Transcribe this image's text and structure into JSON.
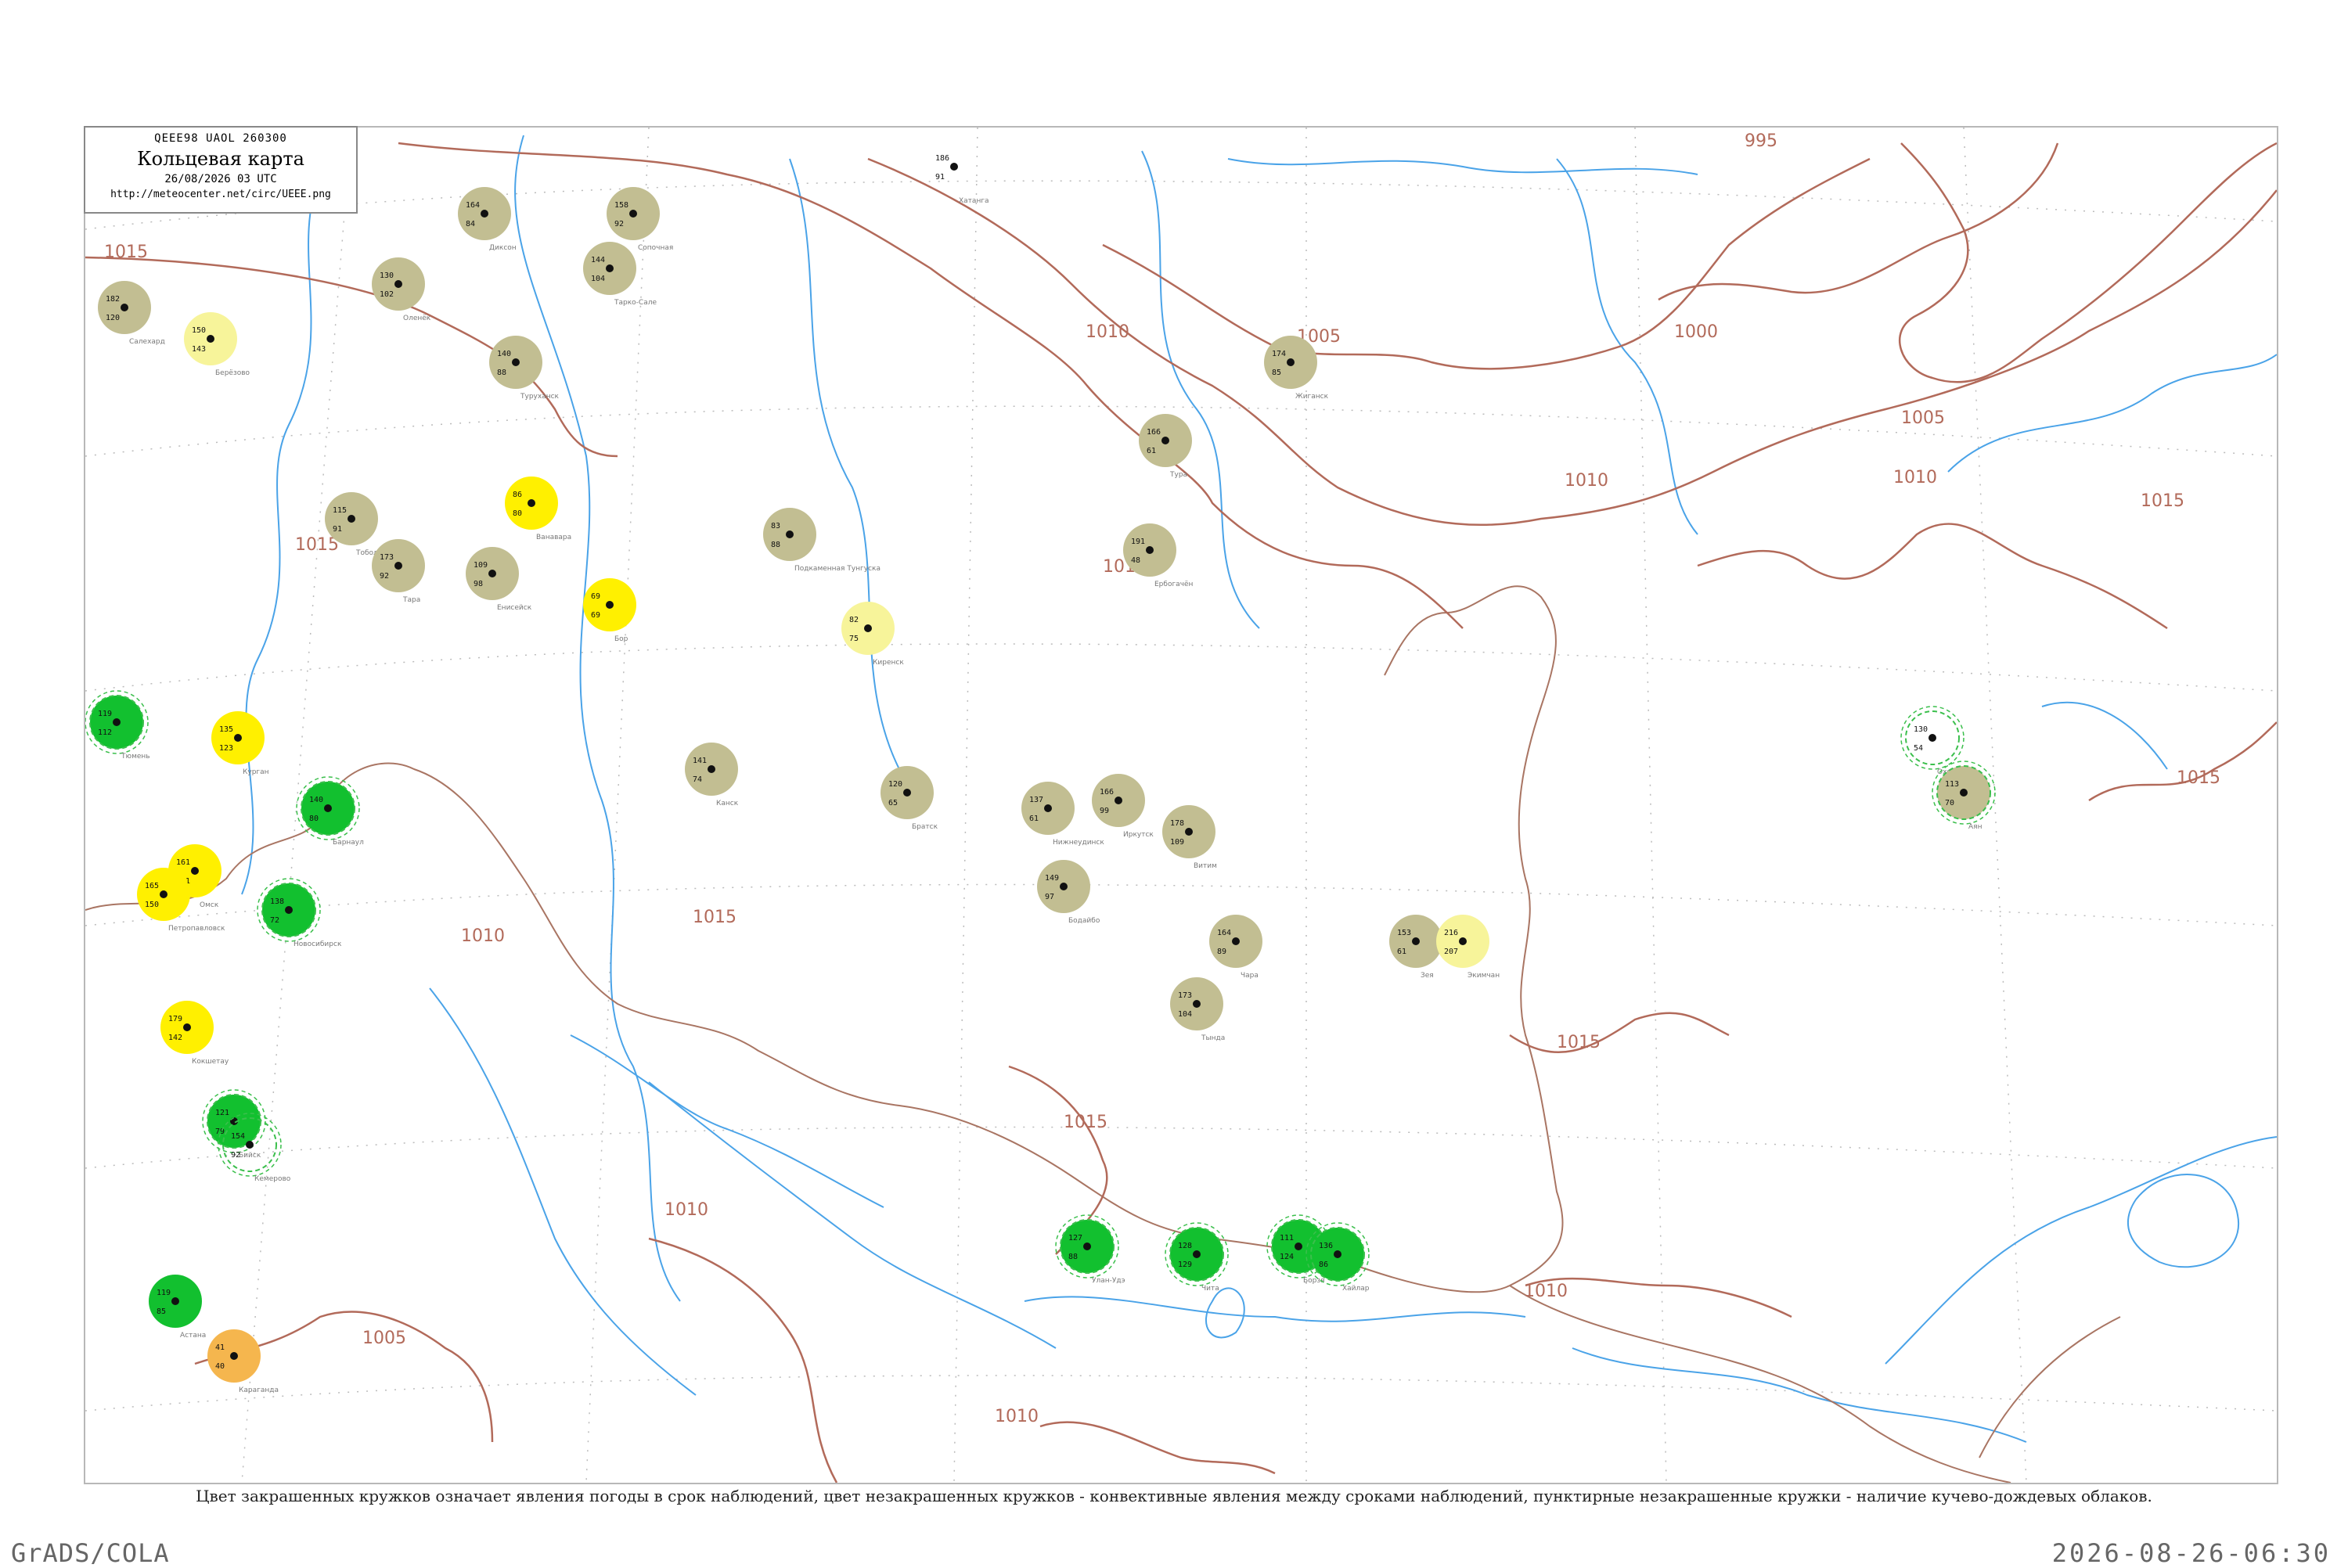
{
  "title": {
    "codes": "QEEE98  UAOL  260300",
    "main": "Кольцевая карта",
    "date": "26/08/2026 03 UTC",
    "url": "http://meteocenter.net/circ/UEEE.png"
  },
  "caption": "Цвет закрашенных кружков означает явления погоды в срок наблюдений, цвет незакрашенных кружков - конвективные явления между сроками наблюдений, пунктирные незакрашенные кружки - наличие кучево-дождевых облаков.",
  "footer": {
    "left": "GrADS/COLA",
    "right": "2026-08-26-06:30"
  },
  "colors": {
    "isobar": "#b26a5a",
    "river": "#4aa3e8",
    "olive": "#c2be92",
    "green": "#12c02f",
    "yellow": "#fff000",
    "light_yellow": "#f7f49a",
    "orange": "#f5b64e",
    "dashed_green": "#3bbf4c"
  },
  "isobars": [
    "1015",
    "1010",
    "1010",
    "1005",
    "1000",
    "995",
    "1005",
    "1010",
    "1015",
    "1010",
    "1015",
    "1010",
    "1015",
    "1010",
    "1005",
    "1010",
    "1015"
  ],
  "stations": [
    {
      "label": "164",
      "sub": "84",
      "name": "Диксон",
      "fill": "olive",
      "dashed": false
    },
    {
      "label": "158",
      "sub": "92",
      "name": "Сопочная",
      "fill": "olive",
      "dashed": false
    },
    {
      "label": "144",
      "sub": "104",
      "name": "Тарко-Сале",
      "fill": "olive",
      "dashed": false
    },
    {
      "label": "186",
      "sub": "91",
      "name": "Хатанга",
      "fill": "none",
      "dashed": false
    },
    {
      "label": "130",
      "sub": "102",
      "name": "Оленёк",
      "fill": "olive",
      "dashed": false
    },
    {
      "label": "182",
      "sub": "120",
      "name": "Салехард",
      "fill": "olive",
      "dashed": false
    },
    {
      "label": "150",
      "sub": "143",
      "name": "Берёзово",
      "fill": "light_yellow",
      "dashed": false
    },
    {
      "label": "140",
      "sub": "88",
      "name": "Туруханск",
      "fill": "olive",
      "dashed": false
    },
    {
      "label": "174",
      "sub": "85",
      "name": "Жиганск",
      "fill": "olive",
      "dashed": false
    },
    {
      "label": "166",
      "sub": "61",
      "name": "Тура",
      "fill": "olive",
      "dashed": false
    },
    {
      "label": "191",
      "sub": "48",
      "name": "Ербогачён",
      "fill": "olive",
      "dashed": false
    },
    {
      "label": "86",
      "sub": "80",
      "name": "Ванавара",
      "fill": "yellow",
      "dashed": false
    },
    {
      "label": "69",
      "sub": "69",
      "name": "Бор",
      "fill": "yellow",
      "dashed": false
    },
    {
      "label": "83",
      "sub": "88",
      "name": "Подкаменная Тунгуска",
      "fill": "olive",
      "dashed": false
    },
    {
      "label": "82",
      "sub": "75",
      "name": "Киренск",
      "fill": "light_yellow",
      "dashed": false
    },
    {
      "label": "115",
      "sub": "91",
      "name": "Тобольск",
      "fill": "olive",
      "dashed": false
    },
    {
      "label": "173",
      "sub": "92",
      "name": "Тара",
      "fill": "olive",
      "dashed": false
    },
    {
      "label": "109",
      "sub": "98",
      "name": "Енисейск",
      "fill": "olive",
      "dashed": false
    },
    {
      "label": "141",
      "sub": "74",
      "name": "Канск",
      "fill": "olive",
      "dashed": false
    },
    {
      "label": "120",
      "sub": "65",
      "name": "Братск",
      "fill": "olive",
      "dashed": false
    },
    {
      "label": "137",
      "sub": "61",
      "name": "Нижнеудинск",
      "fill": "olive",
      "dashed": false
    },
    {
      "label": "166",
      "sub": "99",
      "name": "Иркутск",
      "fill": "olive",
      "dashed": false
    },
    {
      "label": "178",
      "sub": "109",
      "name": "Витим",
      "fill": "olive",
      "dashed": false
    },
    {
      "label": "149",
      "sub": "97",
      "name": "Бодайбо",
      "fill": "olive",
      "dashed": false
    },
    {
      "label": "164",
      "sub": "89",
      "name": "Чара",
      "fill": "olive",
      "dashed": false
    },
    {
      "label": "173",
      "sub": "104",
      "name": "Тында",
      "fill": "olive",
      "dashed": false
    },
    {
      "label": "153",
      "sub": "61",
      "name": "Зея",
      "fill": "olive",
      "dashed": false
    },
    {
      "label": "216",
      "sub": "207",
      "name": "Экимчан",
      "fill": "light_yellow",
      "dashed": false
    },
    {
      "label": "130",
      "sub": "54",
      "name": "Охотск",
      "fill": "none",
      "dashed": true
    },
    {
      "label": "113",
      "sub": "70",
      "name": "Аян",
      "fill": "olive",
      "dashed": true
    },
    {
      "label": "119",
      "sub": "112",
      "name": "Тюмень",
      "fill": "green",
      "dashed": true
    },
    {
      "label": "135",
      "sub": "123",
      "name": "Курган",
      "fill": "yellow",
      "dashed": false
    },
    {
      "label": "161",
      "sub": "141",
      "name": "Омск",
      "fill": "yellow",
      "dashed": false
    },
    {
      "label": "165",
      "sub": "150",
      "name": "Петропавловск",
      "fill": "yellow",
      "dashed": false
    },
    {
      "label": "179",
      "sub": "142",
      "name": "Кокшетау",
      "fill": "yellow",
      "dashed": false
    },
    {
      "label": "138",
      "sub": "72",
      "name": "Новосибирск",
      "fill": "green",
      "dashed": true
    },
    {
      "label": "140",
      "sub": "80",
      "name": "Барнаул",
      "fill": "green",
      "dashed": true
    },
    {
      "label": "121",
      "sub": "79",
      "name": "Бийск",
      "fill": "green",
      "dashed": true
    },
    {
      "label": "154",
      "sub": "92",
      "name": "Кемерово",
      "fill": "none",
      "dashed": true
    },
    {
      "label": "119",
      "sub": "85",
      "name": "Астана",
      "fill": "green",
      "dashed": false
    },
    {
      "label": "41",
      "sub": "40",
      "name": "Караганда",
      "fill": "orange",
      "dashed": false
    },
    {
      "label": "127",
      "sub": "88",
      "name": "Улан-Удэ",
      "fill": "green",
      "dashed": true
    },
    {
      "label": "128",
      "sub": "129",
      "name": "Чита",
      "fill": "green",
      "dashed": true
    },
    {
      "label": "111",
      "sub": "124",
      "name": "Борзя",
      "fill": "green",
      "dashed": true
    },
    {
      "label": "136",
      "sub": "86",
      "name": "Хайлар",
      "fill": "green",
      "dashed": true
    }
  ]
}
